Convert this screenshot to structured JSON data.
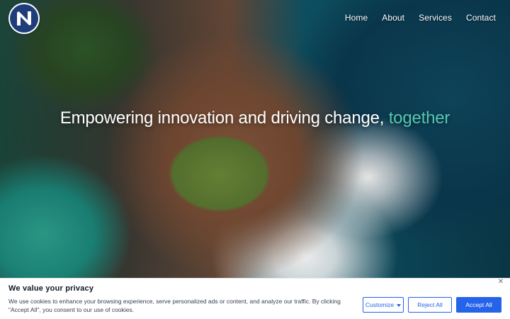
{
  "brand": {
    "logo_icon": "brand-logo-icon"
  },
  "nav": {
    "items": [
      {
        "label": "Home"
      },
      {
        "label": "About"
      },
      {
        "label": "Services"
      },
      {
        "label": "Contact"
      }
    ]
  },
  "hero": {
    "headline_main": "Empowering innovation and driving change,",
    "headline_accent": "together",
    "accent_color": "#55c7b3"
  },
  "cookie_banner": {
    "title": "We value your privacy",
    "text": "We use cookies to enhance your browsing experience, serve personalized ads or content, and analyze our traffic. By clicking \"Accept All\", you consent to our use of cookies.",
    "buttons": {
      "customize": "Customize",
      "reject": "Reject All",
      "accept": "Accept All"
    },
    "close_icon": "close-icon",
    "accent": "#2563eb"
  }
}
